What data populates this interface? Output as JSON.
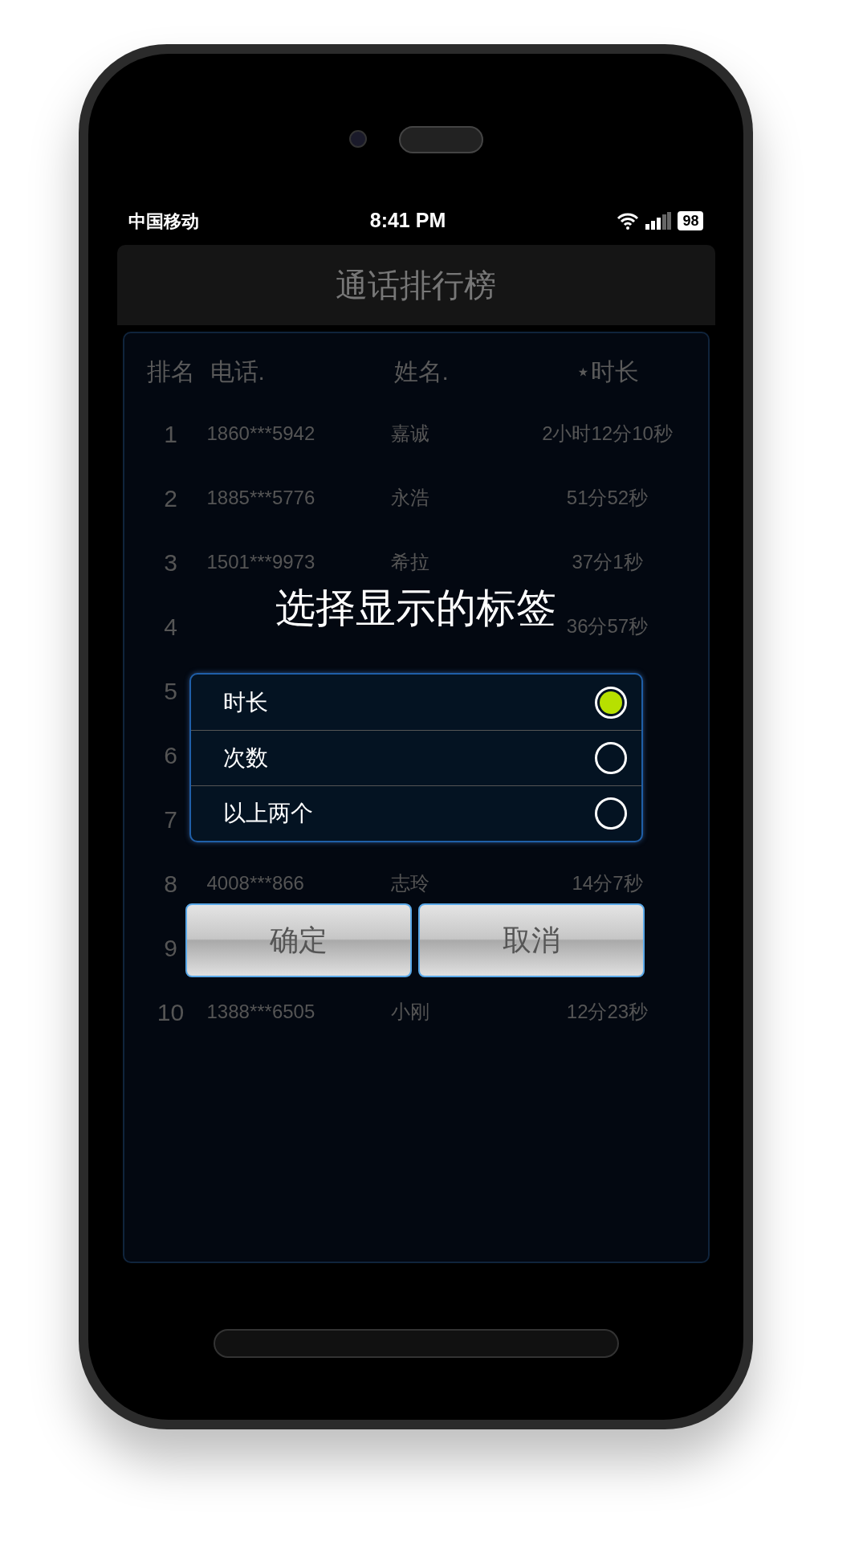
{
  "status_bar": {
    "carrier": "中国移动",
    "time": "8:41 PM",
    "battery": "98"
  },
  "header": {
    "title": "通话排行榜"
  },
  "table": {
    "columns": [
      "排名",
      "电话.",
      "姓名.",
      "⋆时长"
    ],
    "rows": [
      {
        "rank": "1",
        "phone": "1860***5942",
        "name": "嘉诚",
        "duration": "2小时12分10秒"
      },
      {
        "rank": "2",
        "phone": "1885***5776",
        "name": "永浩",
        "duration": "51分52秒"
      },
      {
        "rank": "3",
        "phone": "1501***9973",
        "name": "希拉",
        "duration": "37分1秒"
      },
      {
        "rank": "4",
        "duration": "36分57秒"
      },
      {
        "rank": "5"
      },
      {
        "rank": "6"
      },
      {
        "rank": "7"
      },
      {
        "rank": "8",
        "phone": "4008***866",
        "name": "志玲",
        "duration": "14分7秒"
      },
      {
        "rank": "9"
      },
      {
        "rank": "10",
        "phone": "1388***6505",
        "name": "小刚",
        "duration": "12分23秒"
      }
    ]
  },
  "dialog": {
    "title": "选择显示的标签",
    "options": [
      {
        "label": "时长",
        "selected": true
      },
      {
        "label": "次数",
        "selected": false
      },
      {
        "label": "以上两个",
        "selected": false
      }
    ],
    "buttons": [
      "确定",
      "取消"
    ]
  }
}
